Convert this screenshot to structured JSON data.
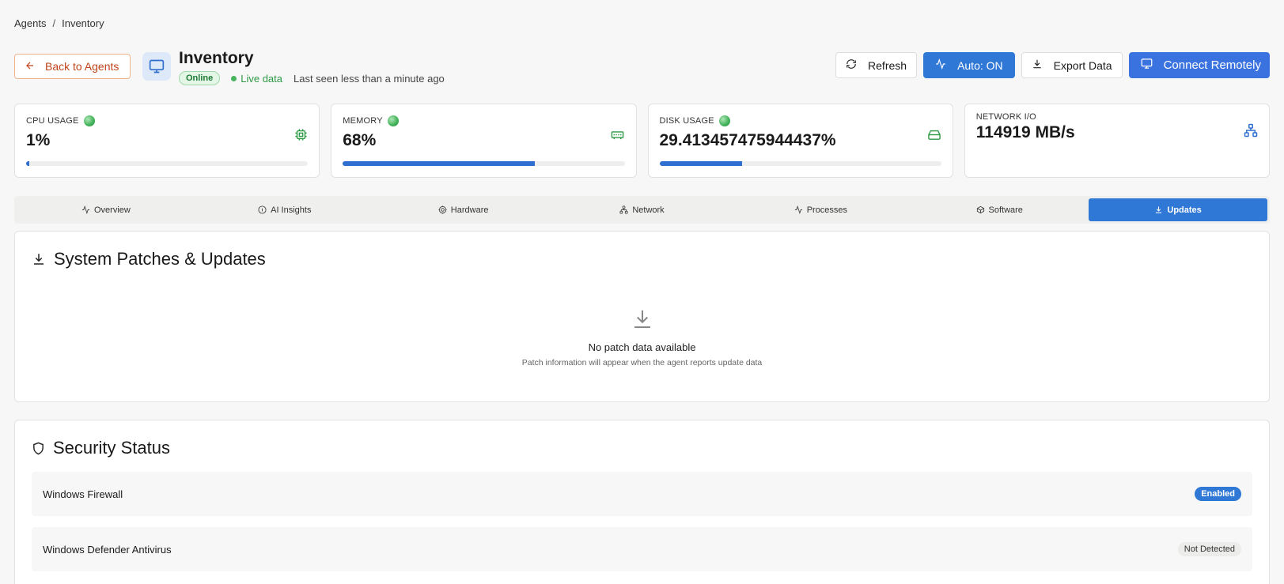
{
  "breadcrumb": {
    "parent": "Agents",
    "separator": "/",
    "current": "Inventory"
  },
  "header": {
    "back_label": "Back to Agents",
    "title": "Inventory",
    "status_badge": "Online",
    "live_label": "Live data",
    "last_seen": "Last seen less than a minute ago",
    "refresh_label": "Refresh",
    "auto_label": "Auto: ON",
    "export_label": "Export Data",
    "connect_label": "Connect Remotely"
  },
  "stats": {
    "cpu": {
      "label": "CPU USAGE",
      "value": "1%",
      "percent": 1,
      "icon": "cpu-icon"
    },
    "memory": {
      "label": "MEMORY",
      "value": "68%",
      "percent": 68,
      "icon": "memory-icon"
    },
    "disk": {
      "label": "DISK USAGE",
      "value": "29.413457475944437%",
      "percent": 29.41,
      "icon": "disk-icon"
    },
    "network": {
      "label": "NETWORK I/O",
      "value": "114919 MB/s",
      "icon": "network-icon"
    }
  },
  "tabs": [
    {
      "label": "Overview",
      "icon": "activity-icon"
    },
    {
      "label": "AI Insights",
      "icon": "info-icon"
    },
    {
      "label": "Hardware",
      "icon": "cog-icon"
    },
    {
      "label": "Network",
      "icon": "network-icon"
    },
    {
      "label": "Processes",
      "icon": "activity-icon"
    },
    {
      "label": "Software",
      "icon": "package-icon"
    },
    {
      "label": "Updates",
      "icon": "download-icon",
      "active": true
    }
  ],
  "patches": {
    "title": "System Patches & Updates",
    "empty_title": "No patch data available",
    "empty_sub": "Patch information will appear when the agent reports update data"
  },
  "security": {
    "title": "Security Status",
    "rows": [
      {
        "name": "Windows Firewall",
        "status": "Enabled"
      },
      {
        "name": "Windows Defender Antivirus",
        "status": "Not Detected"
      }
    ]
  },
  "colors": {
    "primary": "#2f78d6",
    "accent_orange": "#c0441a",
    "success": "#2f9a46"
  }
}
